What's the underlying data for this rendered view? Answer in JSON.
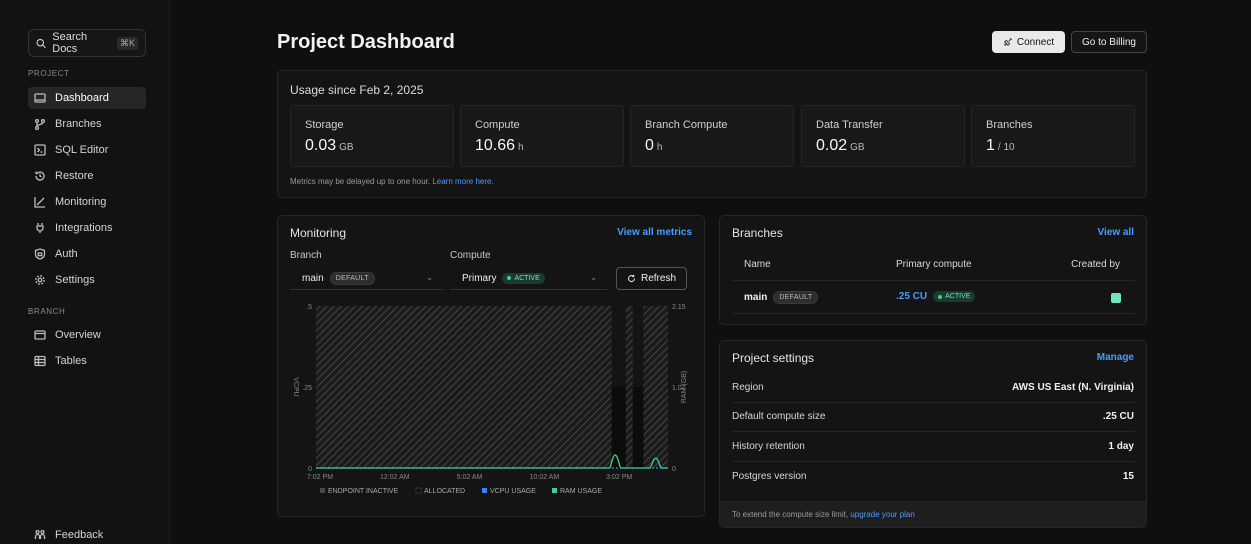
{
  "sidebar": {
    "search_label": "Search Docs",
    "search_kbd": "⌘K",
    "section_project": "PROJECT",
    "project_items": [
      {
        "label": "Dashboard",
        "icon": "monitor-icon"
      },
      {
        "label": "Branches",
        "icon": "branch-icon"
      },
      {
        "label": "SQL Editor",
        "icon": "terminal-icon"
      },
      {
        "label": "Restore",
        "icon": "restore-icon"
      },
      {
        "label": "Monitoring",
        "icon": "chart-icon"
      },
      {
        "label": "Integrations",
        "icon": "integrations-icon"
      },
      {
        "label": "Auth",
        "icon": "shield-icon"
      },
      {
        "label": "Settings",
        "icon": "gear-icon"
      }
    ],
    "section_branch": "BRANCH",
    "branch_items": [
      {
        "label": "Overview",
        "icon": "overview-icon"
      },
      {
        "label": "Tables",
        "icon": "table-icon"
      }
    ],
    "feedback_label": "Feedback"
  },
  "header": {
    "title": "Project Dashboard",
    "connect_label": "Connect",
    "billing_label": "Go to Billing"
  },
  "usage": {
    "title": "Usage since Feb 2, 2025",
    "metrics": [
      {
        "label": "Storage",
        "value": "0.03",
        "unit": "GB"
      },
      {
        "label": "Compute",
        "value": "10.66",
        "unit": "h"
      },
      {
        "label": "Branch Compute",
        "value": "0",
        "unit": "h"
      },
      {
        "label": "Data Transfer",
        "value": "0.02",
        "unit": "GB"
      },
      {
        "label": "Branches",
        "value": "1",
        "unit": "/ 10"
      }
    ],
    "note": "Metrics may be delayed up to one hour.",
    "note_link": "Learn more here."
  },
  "monitoring": {
    "title": "Monitoring",
    "view_all": "View all metrics",
    "branch_label": "Branch",
    "branch_value": "main",
    "branch_badge": "DEFAULT",
    "compute_label": "Compute",
    "compute_value": "Primary",
    "compute_badge": "ACTIVE",
    "refresh_label": "Refresh"
  },
  "chart_data": {
    "type": "area",
    "x_ticks": [
      "7:02 PM",
      "12:02 AM",
      "5:02 AM",
      "10:02 AM",
      "3:02 PM"
    ],
    "y_left_ticks": [
      ".5",
      ".25",
      "0"
    ],
    "y_right_ticks": [
      "2.15",
      "1.07",
      "0"
    ],
    "ylabel_left": "VCPU",
    "ylabel_right": "RAM (GB)",
    "ylim_left": [
      0,
      0.5
    ],
    "ylim_right": [
      0,
      2.15
    ],
    "series": [
      {
        "name": "ENDPOINT INACTIVE",
        "color": "#555555",
        "intervals": [
          [
            0.0,
            0.84
          ],
          [
            0.88,
            0.9
          ],
          [
            0.93,
            1.0
          ]
        ]
      },
      {
        "name": "ALLOCATED",
        "color": "#1a1a1a",
        "intervals": [
          [
            0.84,
            0.88
          ],
          [
            0.9,
            0.93
          ]
        ],
        "value": 0.25
      },
      {
        "name": "VCPU USAGE",
        "color": "#3b82f6",
        "value": 0
      },
      {
        "name": "RAM USAGE",
        "color": "#3ecf8e",
        "peaks": [
          {
            "x": 0.85,
            "value": 0.04
          },
          {
            "x": 0.965,
            "value": 0.03
          }
        ]
      }
    ]
  },
  "branches": {
    "title": "Branches",
    "view_all": "View all",
    "col_name": "Name",
    "col_compute": "Primary compute",
    "col_created": "Created by",
    "row": {
      "name": "main",
      "badge": "DEFAULT",
      "compute": ".25 CU",
      "compute_badge": "ACTIVE"
    }
  },
  "project_settings": {
    "title": "Project settings",
    "manage": "Manage",
    "rows": [
      {
        "label": "Region",
        "value": "AWS US East (N. Virginia)"
      },
      {
        "label": "Default compute size",
        "value": ".25 CU"
      },
      {
        "label": "History retention",
        "value": "1 day"
      },
      {
        "label": "Postgres version",
        "value": "15"
      }
    ],
    "footer_text": "To extend the compute size limit,",
    "footer_link": "upgrade your plan"
  }
}
